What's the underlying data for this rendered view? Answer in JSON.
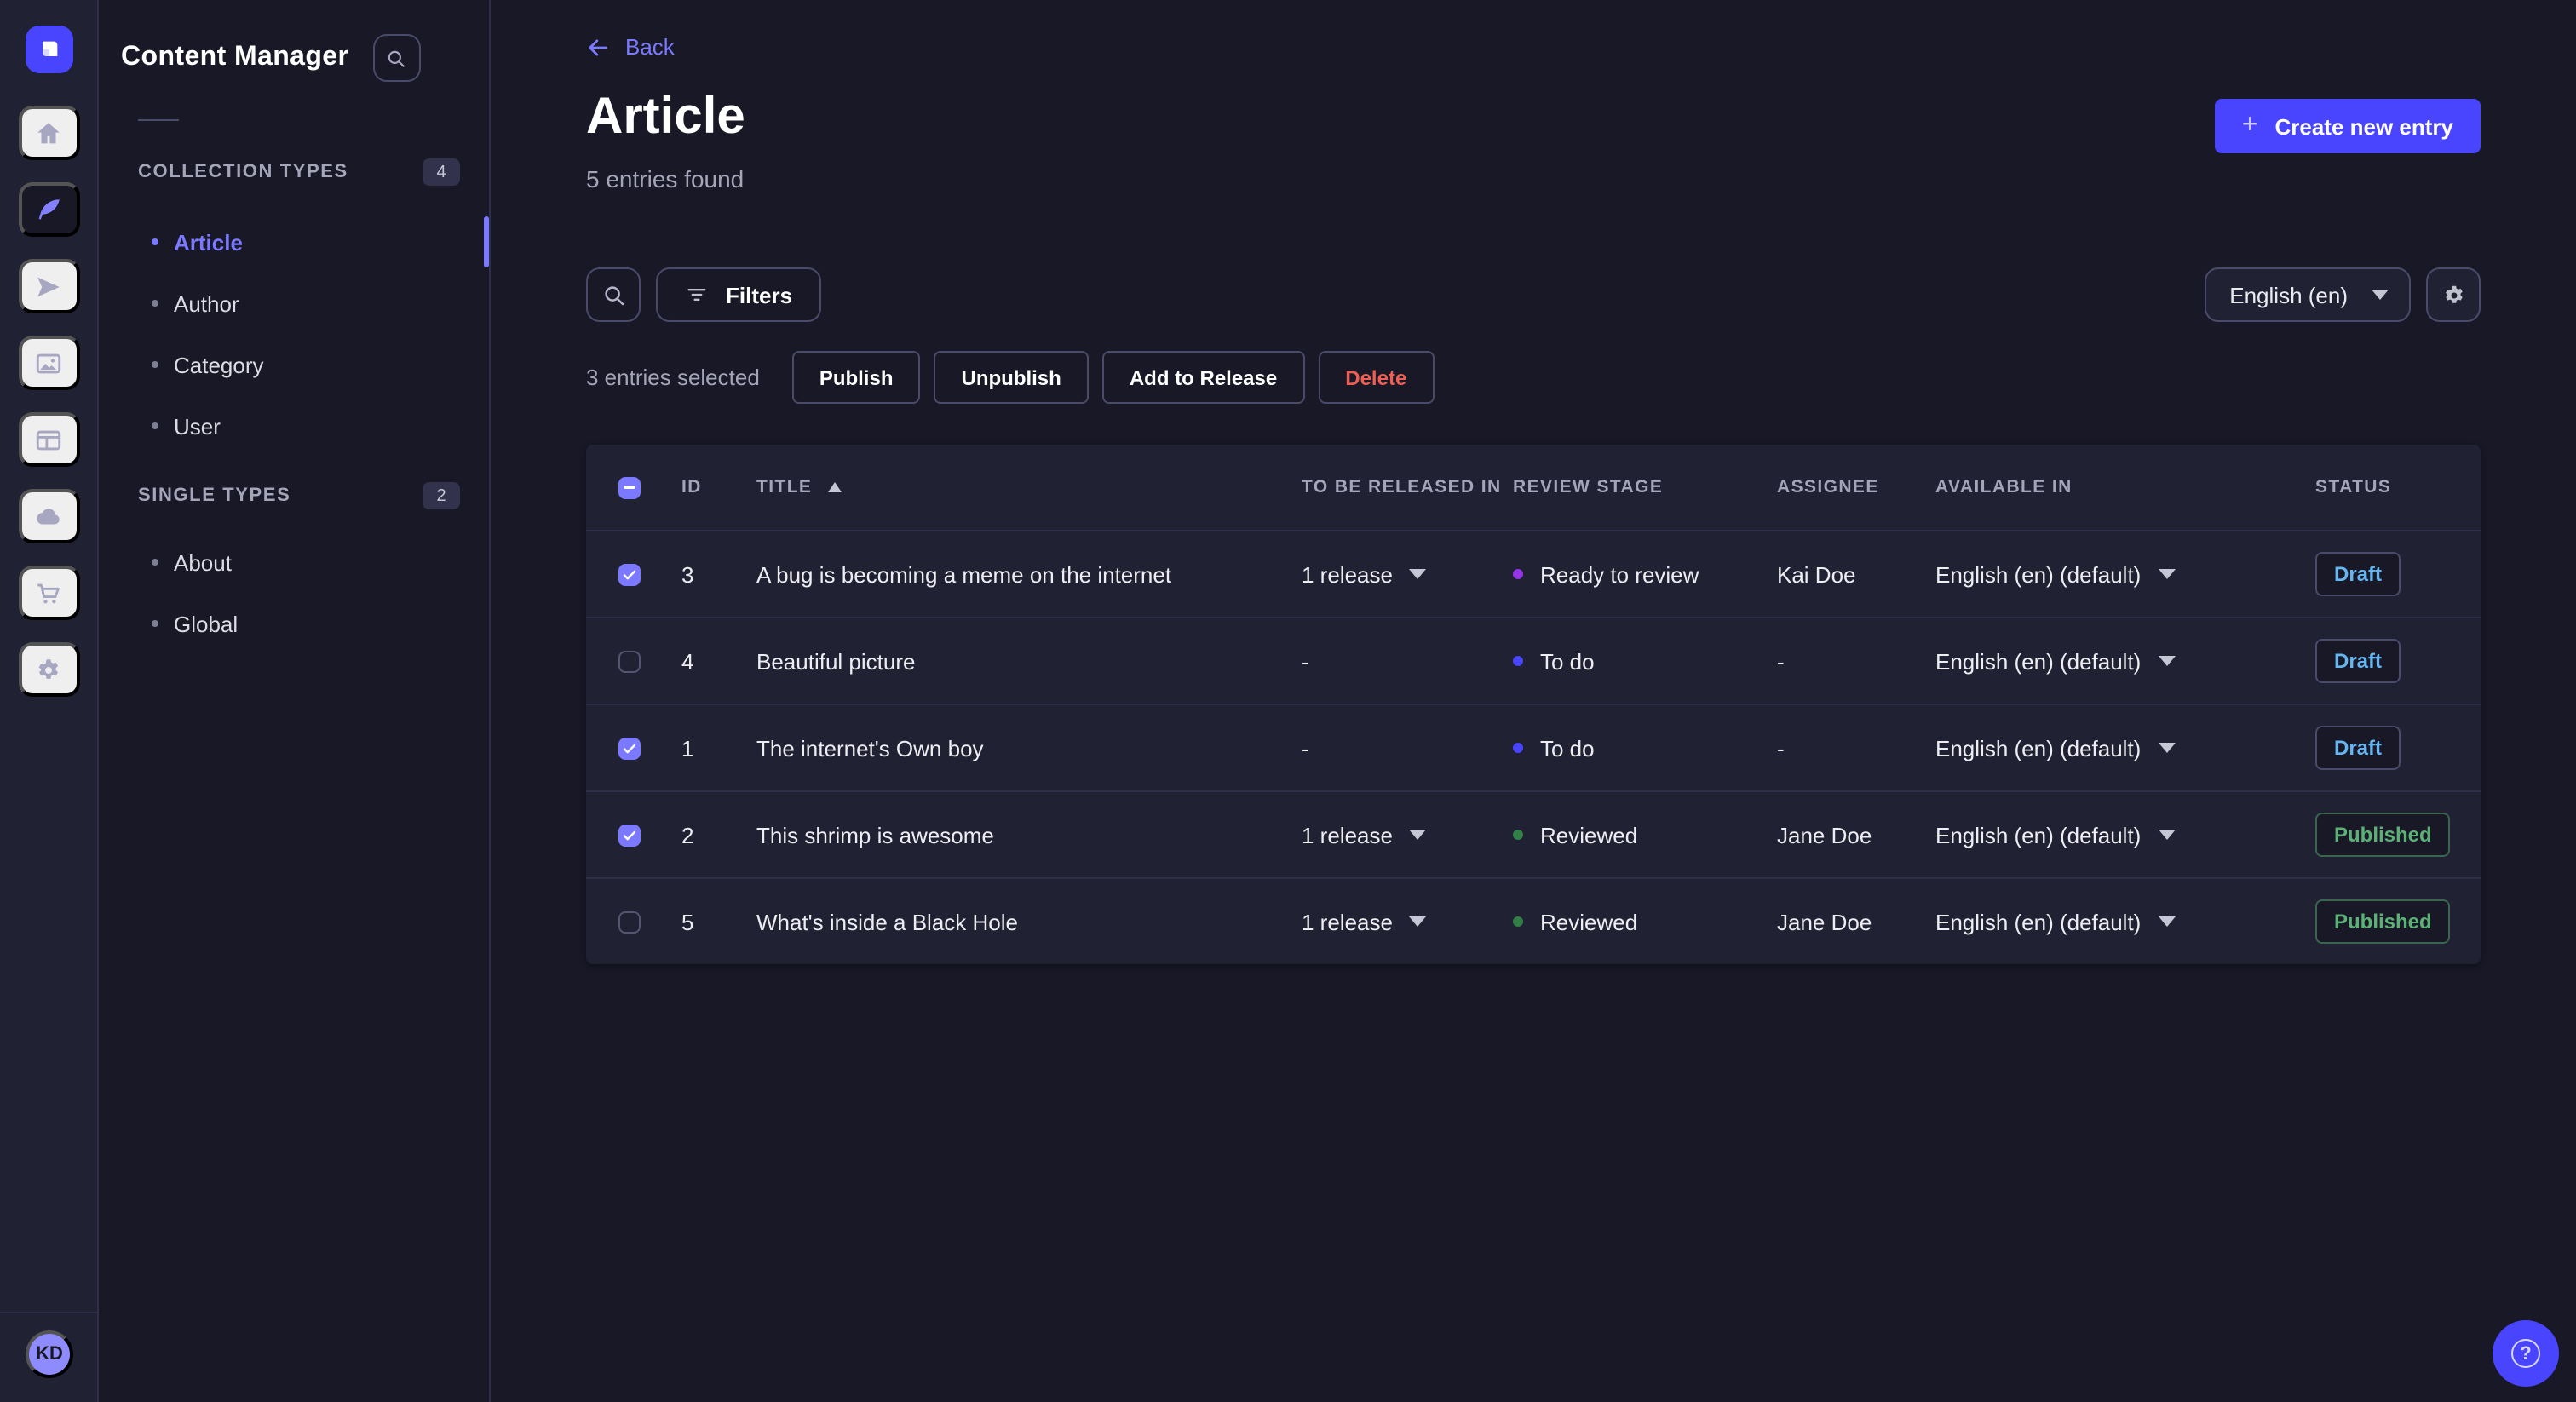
{
  "colors": {
    "primary": "#4945FF",
    "primary_light": "#7B79FF",
    "danger": "#EE5E52",
    "draft": "#66B7F1",
    "published": "#5CB176",
    "stage_todo": "#4945FF",
    "stage_ready_to_review": "#9736E8",
    "stage_reviewed": "#328048"
  },
  "rail": {
    "items": [
      {
        "name": "home"
      },
      {
        "name": "content-manager",
        "active": true
      },
      {
        "name": "releases"
      },
      {
        "name": "media-library"
      },
      {
        "name": "content-type-builder"
      },
      {
        "name": "deploy"
      },
      {
        "name": "marketplace"
      },
      {
        "name": "settings"
      }
    ],
    "avatar_initials": "KD"
  },
  "subnav": {
    "title": "Content Manager",
    "sections": [
      {
        "label": "COLLECTION TYPES",
        "count": "4",
        "items": [
          {
            "label": "Article",
            "active": true
          },
          {
            "label": "Author"
          },
          {
            "label": "Category"
          },
          {
            "label": "User"
          }
        ]
      },
      {
        "label": "SINGLE TYPES",
        "count": "2",
        "items": [
          {
            "label": "About"
          },
          {
            "label": "Global"
          }
        ]
      }
    ]
  },
  "header": {
    "back_label": "Back",
    "title": "Article",
    "subtitle": "5 entries found",
    "create_label": "Create new entry"
  },
  "toolbar": {
    "filters_label": "Filters",
    "locale_value": "English (en)"
  },
  "selection": {
    "summary": "3 entries selected",
    "publish_label": "Publish",
    "unpublish_label": "Unpublish",
    "release_label": "Add to Release",
    "delete_label": "Delete"
  },
  "table": {
    "headers": {
      "id": "ID",
      "title": "TITLE",
      "release": "TO BE RELEASED IN",
      "stage": "REVIEW STAGE",
      "assignee": "ASSIGNEE",
      "available": "AVAILABLE IN",
      "status": "STATUS"
    },
    "rows": [
      {
        "checked": true,
        "id": "3",
        "title": "A bug is becoming a meme on the internet",
        "release": "1 release",
        "stage": "Ready to review",
        "stage_color": "#9736E8",
        "assignee": "Kai Doe",
        "available": "English (en) (default)",
        "status": "Draft"
      },
      {
        "checked": false,
        "id": "4",
        "title": "Beautiful picture",
        "release": "-",
        "stage": "To do",
        "stage_color": "#4945FF",
        "assignee": "-",
        "available": "English (en) (default)",
        "status": "Draft"
      },
      {
        "checked": true,
        "id": "1",
        "title": "The internet's Own boy",
        "release": "-",
        "stage": "To do",
        "stage_color": "#4945FF",
        "assignee": "-",
        "available": "English (en) (default)",
        "status": "Draft"
      },
      {
        "checked": true,
        "id": "2",
        "title": "This shrimp is awesome",
        "release": "1 release",
        "stage": "Reviewed",
        "stage_color": "#328048",
        "assignee": "Jane Doe",
        "available": "English (en) (default)",
        "status": "Published"
      },
      {
        "checked": false,
        "id": "5",
        "title": "What's inside a Black Hole",
        "release": "1 release",
        "stage": "Reviewed",
        "stage_color": "#328048",
        "assignee": "Jane Doe",
        "available": "English (en) (default)",
        "status": "Published"
      }
    ]
  },
  "help": {
    "icon": "?"
  }
}
